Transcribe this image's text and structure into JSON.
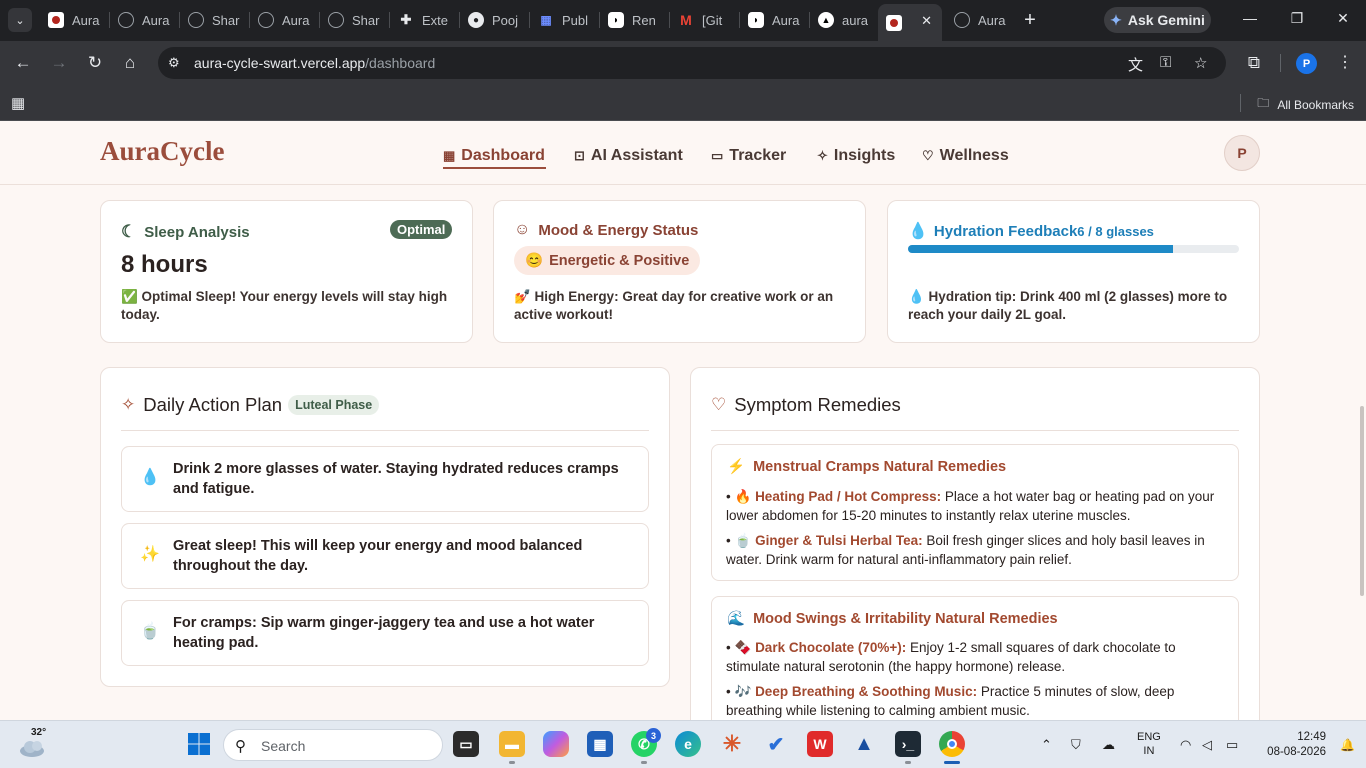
{
  "browser": {
    "tabs": [
      {
        "label": "Aura",
        "icon": "record-icon"
      },
      {
        "label": "Aura",
        "icon": "globe-icon"
      },
      {
        "label": "Shar",
        "icon": "globe-icon"
      },
      {
        "label": "Aura",
        "icon": "globe-icon"
      },
      {
        "label": "Shar",
        "icon": "globe-icon"
      },
      {
        "label": "Exte",
        "icon": "puzzle-icon"
      },
      {
        "label": "Pooj",
        "icon": "github-icon"
      },
      {
        "label": "Publ",
        "icon": "grid-icon"
      },
      {
        "label": "Ren",
        "icon": "render-icon"
      },
      {
        "label": "[Git",
        "icon": "gmail-icon"
      },
      {
        "label": "Aura",
        "icon": "render-icon"
      },
      {
        "label": "aura",
        "icon": "vercel-icon"
      },
      {
        "label": "",
        "icon": "record-icon",
        "active": true
      },
      {
        "label": "Aura",
        "icon": "globe-icon"
      }
    ],
    "gemini_label": "Ask Gemini",
    "url_host": "aura-cycle-swart.vercel.app",
    "url_path": "/dashboard",
    "profile_initial": "P",
    "all_bookmarks_label": "All Bookmarks"
  },
  "app": {
    "logo": "AuraCycle",
    "nav": [
      {
        "label": "Dashboard",
        "icon": "grid-icon",
        "active": true
      },
      {
        "label": "AI Assistant",
        "icon": "robot-icon"
      },
      {
        "label": "Tracker",
        "icon": "calendar-icon"
      },
      {
        "label": "Insights",
        "icon": "sparkle-icon"
      },
      {
        "label": "Wellness",
        "icon": "heart-icon"
      }
    ],
    "avatar_initial": "P"
  },
  "cards": {
    "sleep": {
      "title": "Sleep Analysis",
      "badge": "Optimal",
      "value": "8 hours",
      "message": "✅ Optimal Sleep! Your energy levels will stay high today."
    },
    "mood": {
      "title": "Mood & Energy Status",
      "pill_emoji": "😊",
      "pill_label": "Energetic & Positive",
      "message": "💅 High Energy: Great day for creative work or an active workout!"
    },
    "hydration": {
      "title": "Hydration Feedback",
      "count": "6 / 8 glasses",
      "progress": 0.8,
      "message": "💧 Hydration tip: Drink 400 ml (2 glasses) more to reach your daily 2L goal."
    }
  },
  "action_plan": {
    "title": "Daily Action Plan",
    "phase": "Luteal Phase",
    "items": [
      {
        "icon": "💧",
        "text": "Drink 2 more glasses of water. Staying hydrated reduces cramps and fatigue."
      },
      {
        "icon": "✨",
        "text": "Great sleep! This will keep your energy and mood balanced throughout the day."
      },
      {
        "icon": "🍵",
        "text": "For cramps: Sip warm ginger-jaggery tea and use a hot water heating pad."
      }
    ]
  },
  "remedies": {
    "title": "Symptom Remedies",
    "groups": [
      {
        "icon": "⚡",
        "title": "Menstrual Cramps Natural Remedies",
        "items": [
          {
            "emoji": "🔥",
            "name": "Heating Pad / Hot Compress:",
            "text": "Place a hot water bag or heating pad on your lower abdomen for 15-20 minutes to instantly relax uterine muscles."
          },
          {
            "emoji": "🍵",
            "name": "Ginger & Tulsi Herbal Tea:",
            "text": "Boil fresh ginger slices and holy basil leaves in water. Drink warm for natural anti-inflammatory pain relief."
          }
        ]
      },
      {
        "icon": "🌊",
        "title": "Mood Swings & Irritability Natural Remedies",
        "items": [
          {
            "emoji": "🍫",
            "name": "Dark Chocolate (70%+):",
            "text": "Enjoy 1-2 small squares of dark chocolate to stimulate natural serotonin (the happy hormone) release."
          },
          {
            "emoji": "🎶",
            "name": "Deep Breathing & Soothing Music:",
            "text": "Practice 5 minutes of slow, deep breathing while listening to calming ambient music."
          }
        ]
      }
    ]
  },
  "taskbar": {
    "temperature": "32°",
    "search_placeholder": "Search",
    "whatsapp_badge": "3",
    "lang_line1": "ENG",
    "lang_line2": "IN",
    "time": "12:49",
    "date": "08-08-2026"
  }
}
